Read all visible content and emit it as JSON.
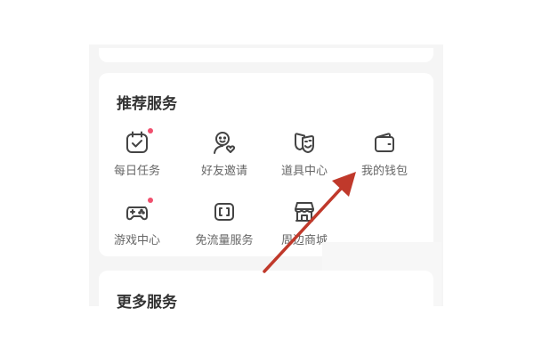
{
  "sections": {
    "recommend_title": "推荐服务",
    "more_title": "更多服务"
  },
  "services": [
    {
      "label": "每日任务",
      "icon": "calendar-check-icon",
      "badge": true
    },
    {
      "label": "好友邀请",
      "icon": "invite-friend-icon",
      "badge": false
    },
    {
      "label": "道具中心",
      "icon": "theater-mask-icon",
      "badge": false
    },
    {
      "label": "我的钱包",
      "icon": "wallet-icon",
      "badge": false
    },
    {
      "label": "游戏中心",
      "icon": "gamepad-icon",
      "badge": true
    },
    {
      "label": "免流量服务",
      "icon": "data-card-icon",
      "badge": false
    },
    {
      "label": "周边商城",
      "icon": "store-icon",
      "badge": false
    }
  ],
  "colors": {
    "arrow": "#c0392b",
    "badge": "#f0506e",
    "icon": "#444444",
    "label": "#666666",
    "title": "#333333",
    "background": "#f5f5f5"
  }
}
